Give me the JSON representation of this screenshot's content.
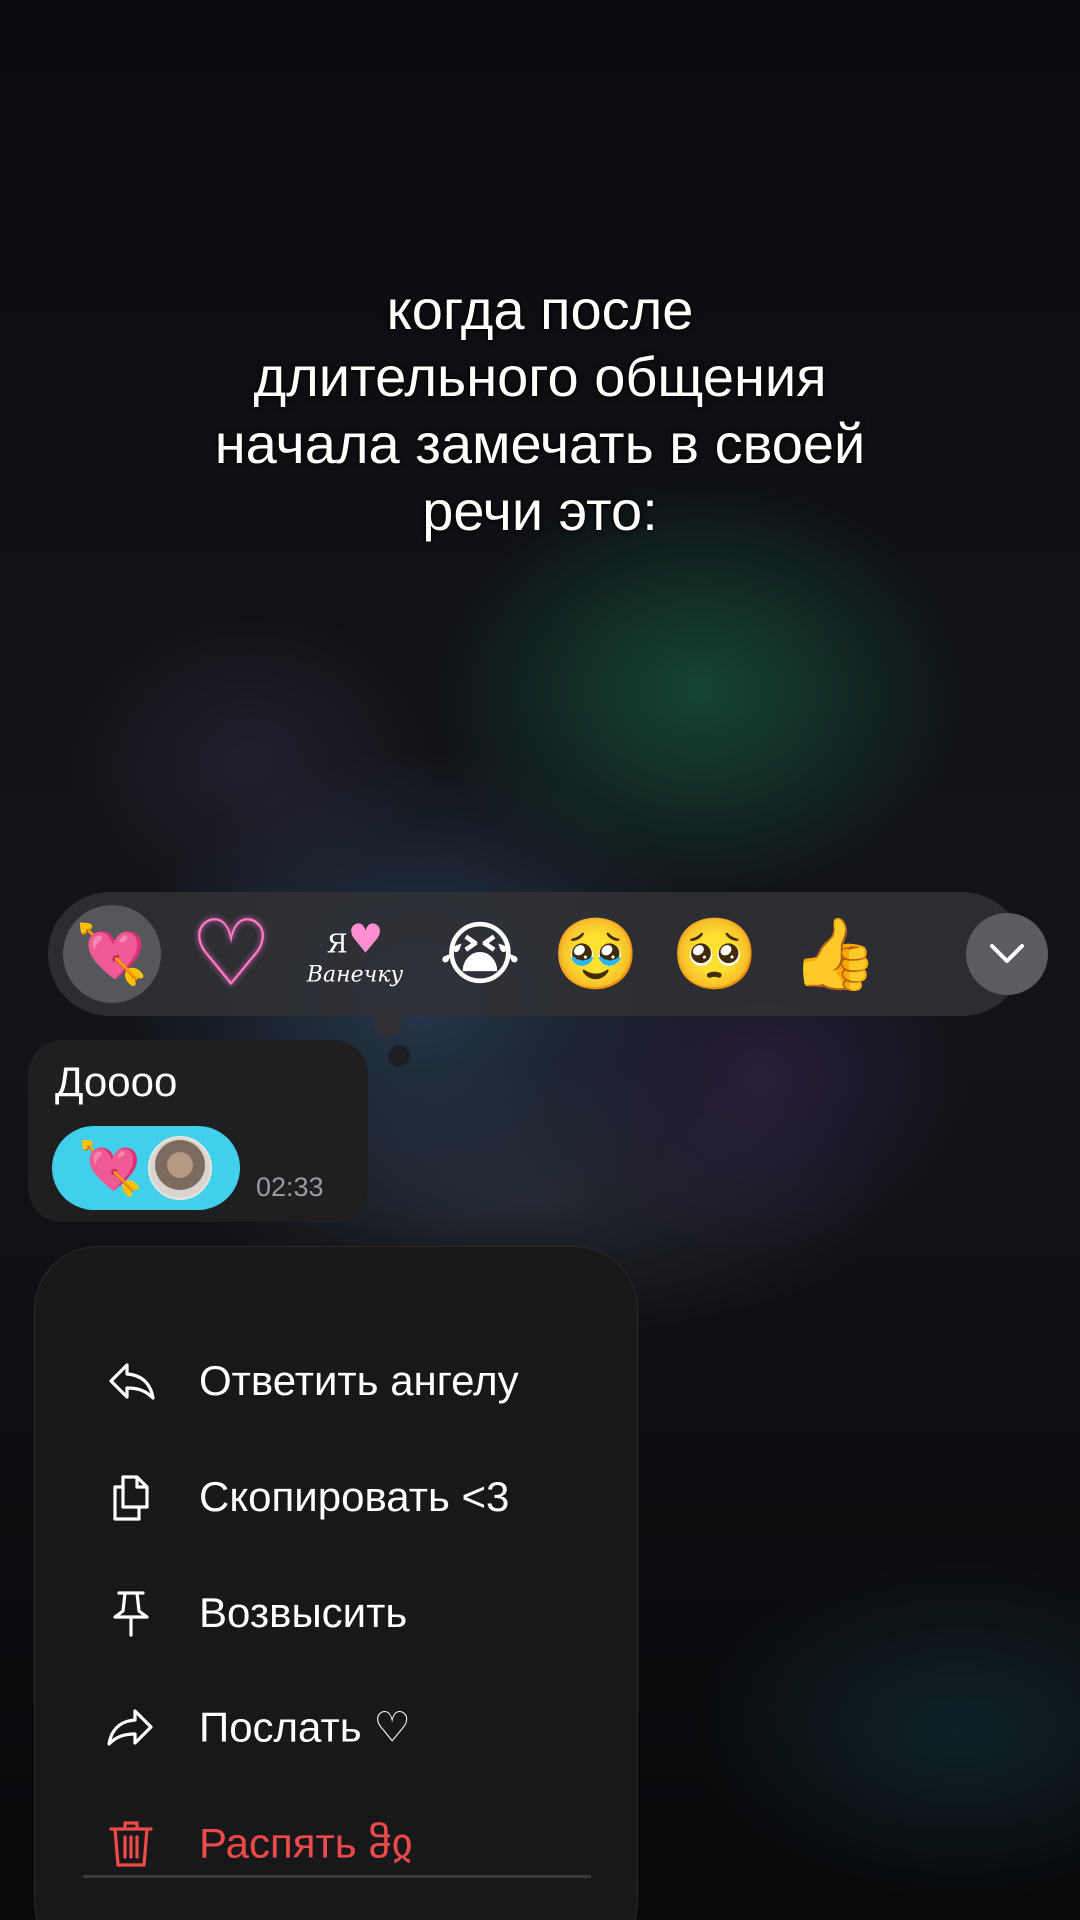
{
  "caption": "когда после\nдлительного общения\nначала замечать в своей\nречи это:",
  "reaction_bar": {
    "items": [
      {
        "name": "heart-with-arrow",
        "glyph": "💘",
        "selected": true
      },
      {
        "name": "pixel-heart",
        "glyph": "♡"
      },
      {
        "name": "ya-lyublyu-vanechku-sticker",
        "top": "Я",
        "heart": "♥",
        "bottom": "Ванечку"
      },
      {
        "name": "loudly-crying-face",
        "glyph": "😭"
      },
      {
        "name": "hand-over-cheek-face",
        "glyph": "🥹"
      },
      {
        "name": "pleading-face",
        "glyph": "🥺"
      },
      {
        "name": "thumbs-up",
        "glyph": "👍"
      }
    ],
    "expand_icon": "chevron-down-icon"
  },
  "message": {
    "text": "Доооо",
    "time": "02:33",
    "reaction": {
      "glyph": "💘",
      "pill_color": "#40d0eb"
    }
  },
  "menu": {
    "items": [
      {
        "label": "Ответить ангелу",
        "icon": "reply-icon"
      },
      {
        "label": "Скопировать <3",
        "icon": "copy-icon"
      },
      {
        "label": "Возвысить",
        "icon": "pin-icon"
      },
      {
        "label": "Послать ♡",
        "icon": "forward-icon"
      },
      {
        "label": "Распять ჵჲ",
        "icon": "trash-icon",
        "danger": true
      }
    ],
    "danger_color": "#ee4a4a"
  }
}
